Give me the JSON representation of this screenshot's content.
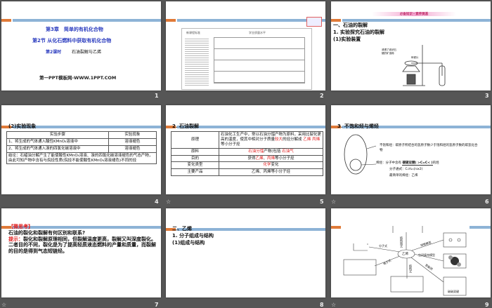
{
  "slides": [
    {
      "number": "1",
      "chapter": "第3章　简单的有机化合物",
      "section": "第2节 从化石燃料中获取有机化合物",
      "lesson_label": "第2课时",
      "lesson_title": "石油裂解与乙烯",
      "site": "第一PPT模板网-WWW.1PPT.COM"
    },
    {
      "number": "2",
      "left_header": "新课程标准",
      "right_header": "学业质量水平"
    },
    {
      "number": "3",
      "banner": "必备知识・素养奠基",
      "h1": "一、石油的裂解",
      "h2": "1. 实验探究石油的裂解",
      "h3": "(1)实验装置",
      "label1": "浸透了液状石蜡的矿渣棉",
      "label2": "碎瓷片"
    },
    {
      "number": "4",
      "title": "(2)实验现象",
      "headers": [
        "实验步骤",
        "实验现象"
      ],
      "rows": [
        [
          "1、将生成的气体通入酸性KMnO₄溶液中",
          "溶液褪色"
        ],
        [
          "2、将生成的气体通入溴的四氯化碳溶液中",
          "溶液褪色"
        ]
      ],
      "conclusion": "结论：石蜡油分解产生了能使酸性KMnO₄溶液、溴的四氯化碳溶液褪色的气态产物，由此可知产物中含有与烷烃性质(烷烃不能使酸性KMnO₄溶液褪色)不同的烃"
    },
    {
      "number": "5",
      "title": "2. 石油裂解",
      "rows": [
        {
          "label": "原理",
          "text": "石油化工生产中，常以石油分馏产物为原料，采用比裂化更高的温度，使其中相对分子质量",
          "r1": "较大",
          "text2": "的烃分解成",
          "r2": "乙烯",
          "r3": "丙烯",
          "text3": "等小分子烃"
        },
        {
          "label": "原料",
          "r1": "石油分馏",
          "text": "产物(包括",
          "r2": "石油气"
        },
        {
          "label": "目的",
          "text": "获得",
          "r1": "乙烯",
          "sep": "、",
          "r2": "丙烯",
          "text2": "等小分子烃"
        },
        {
          "label": "变化类型",
          "r1": "化学",
          "text": "变化"
        },
        {
          "label": "主要产品",
          "text": "乙烯、丙烯等小分子烃"
        }
      ]
    },
    {
      "number": "6",
      "title": "3. 不饱和烃与烯烃",
      "def1": "不饱和烃：碳原子所结合的氢原子数少于饱和烃的氢原子数的碳氢化合物",
      "def2_prefix": "烯烃：分子中含有",
      "def2_box": "碳碳双键( >C=C< )",
      "def2_suffix": "的烃",
      "formula": "分子通式：CₙH₂ₙ(n≥2)",
      "simplest": "最简单的烯烃：乙烯"
    },
    {
      "number": "7",
      "tag": "【微思考】",
      "question": "石油的裂化和裂解有何区别和联系?",
      "hint_label": "提示：",
      "hint": "裂化和裂解原理相同，但裂解温度更高，裂解又叫深度裂化。二者目的不同，裂化是为了提高轻质液态燃料的产量和质量，而裂解的目的是得到气态短链烃。"
    },
    {
      "number": "8",
      "h1": "二、乙烯",
      "h2": "1. 分子组成与结构",
      "h3": "(1)组成与结构"
    },
    {
      "number": "9",
      "center": "乙烯",
      "branches": [
        "分子式",
        "电子式",
        "结构式",
        "结构简式",
        "球棍模型",
        "空间填充模型",
        "官能团"
      ],
      "bond": "碳碳双键"
    }
  ],
  "star_icon": "☆"
}
